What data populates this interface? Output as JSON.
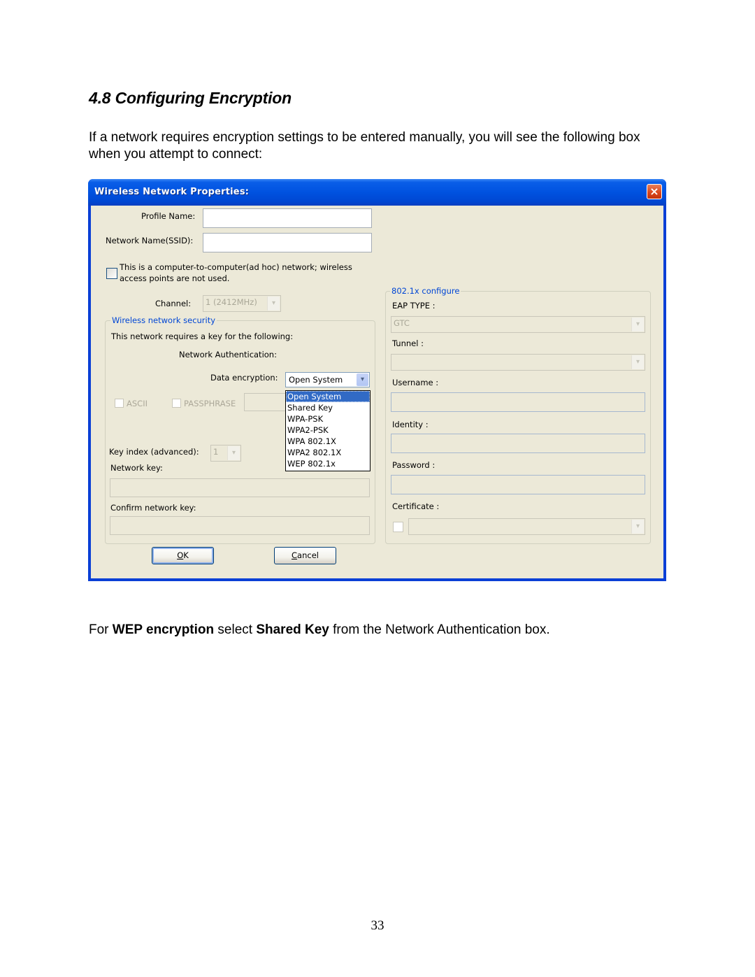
{
  "document": {
    "heading": "4.8 Configuring Encryption",
    "intro": "If a network requires encryption settings to be entered manually, you will see the following box when you attempt to connect:",
    "note": {
      "p1": "For ",
      "b1": "WEP encryption",
      "p2": " select ",
      "b2": "Shared Key",
      "p3": " from the Network Authentication box."
    },
    "page_number": "33"
  },
  "dialog": {
    "title": "Wireless Network Properties:",
    "close_icon": "×",
    "profile_name_label": "Profile Name:",
    "profile_name_value": "",
    "ssid_label": "Network Name(SSID):",
    "ssid_value": "",
    "adhoc_label_line1": "This is a computer-to-computer(ad hoc) network; wireless",
    "adhoc_label_line2": "access points are not used.",
    "adhoc_checked": false,
    "channel_label": "Channel:",
    "channel_value": "1  (2412MHz)",
    "security": {
      "group_label": "Wireless network security",
      "requires_key_text": "This network requires a key for the following:",
      "auth_label": "Network Authentication:",
      "auth_value": "Open System",
      "auth_options": [
        "Open System",
        "Shared Key",
        "WPA-PSK",
        "WPA2-PSK",
        "WPA 802.1X",
        "WPA2 802.1X",
        "WEP 802.1x"
      ],
      "auth_highlighted": "Open System",
      "encryption_label": "Data encryption:",
      "ascii_label": "ASCII",
      "passphrase_label": "PASSPHRASE",
      "key_index_label": "Key index (advanced):",
      "key_index_value": "1",
      "network_key_label": "Network key:",
      "confirm_key_label": "Confirm network key:"
    },
    "eap": {
      "group_label": "802.1x configure",
      "eap_type_label": "EAP TYPE :",
      "eap_type_value": "GTC",
      "tunnel_label": "Tunnel :",
      "tunnel_value": "",
      "username_label": "Username :",
      "identity_label": "Identity :",
      "password_label": "Password :",
      "certificate_label": "Certificate :"
    },
    "ok_label": "OK",
    "ok_mnemonic": "O",
    "ok_rest": "K",
    "cancel_mnemonic": "C",
    "cancel_rest": "ancel",
    "dropdown_arrow": "▾"
  }
}
